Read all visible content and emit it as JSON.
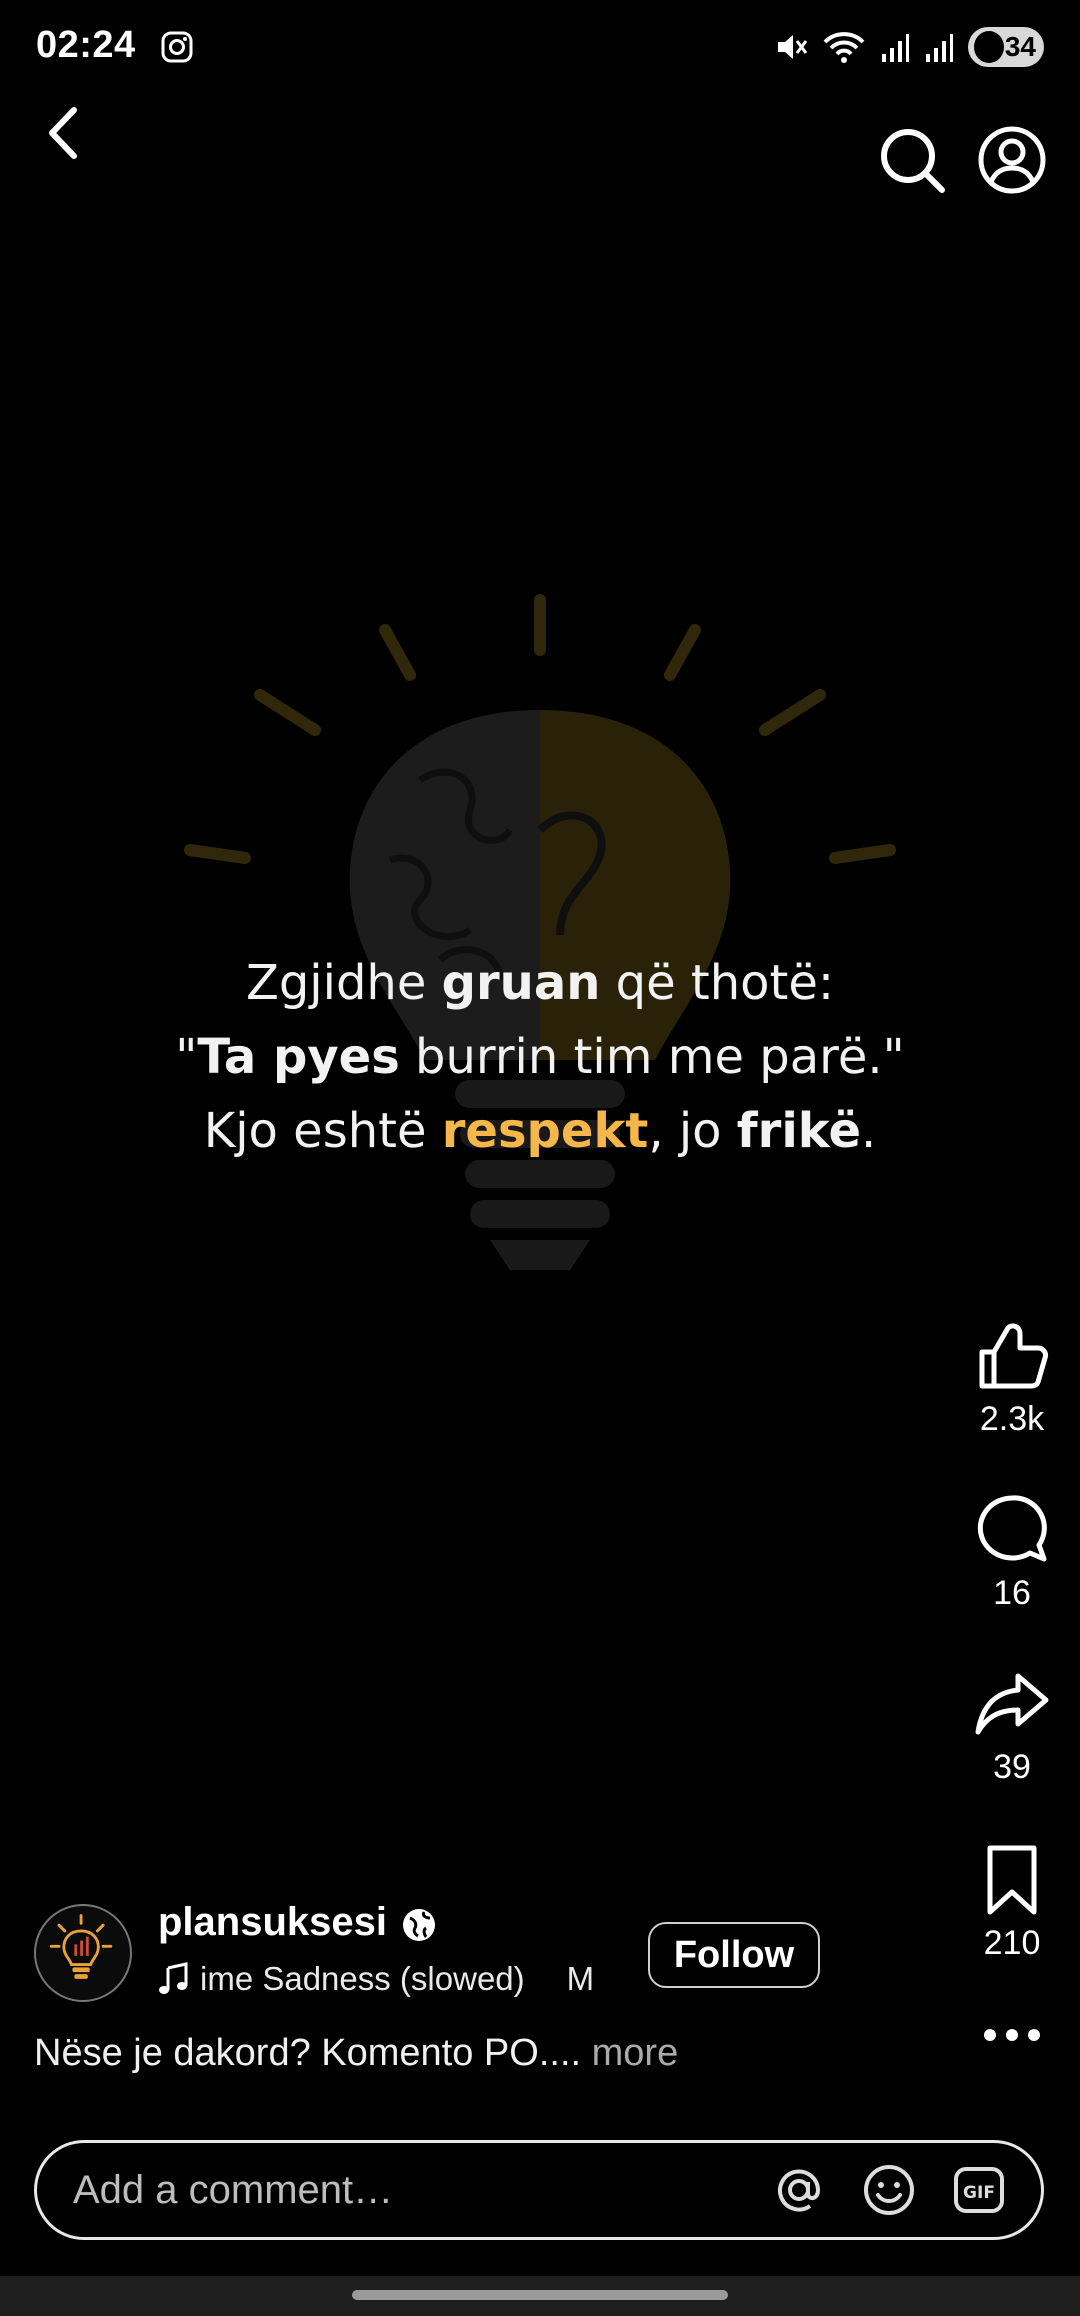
{
  "status_bar": {
    "time": "02:24",
    "battery": "34",
    "icons": [
      "instagram-icon",
      "mute-icon",
      "wifi-icon",
      "signal-icon",
      "signal-r-icon",
      "battery-icon"
    ]
  },
  "nav": {
    "back_icon": "chevron-left-icon",
    "search_icon": "search-icon",
    "profile_icon": "profile-icon"
  },
  "post": {
    "quote": {
      "line1_pre": "Zgjidhe ",
      "line1_bold": "gruan",
      "line1_post": " që thotë:",
      "line2_pre": "\"",
      "line2_bold": "Ta pyes",
      "line2_post": " burrin tim me parë.\"",
      "line3_pre": "Kjo eshtë ",
      "line3_highlight": "respekt",
      "line3_mid": ", jo ",
      "line3_bold": "frikë",
      "line3_post": "."
    },
    "accent_color": "#f5b64a"
  },
  "actions": {
    "likes": "2.3k",
    "comments": "16",
    "shares": "39",
    "saves": "210"
  },
  "author": {
    "username": "plansuksesi",
    "audio": "ime Sadness (slowed)",
    "audio_extra": "M",
    "follow_label": "Follow"
  },
  "caption": {
    "text": "Nëse je dakord? Komento PO....",
    "more_label": " more"
  },
  "comment": {
    "placeholder": "Add a comment…"
  }
}
